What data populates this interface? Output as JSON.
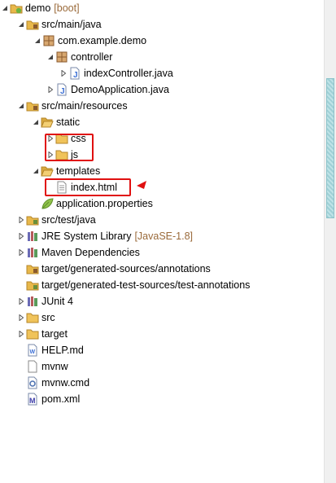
{
  "colors": {
    "annotation": "#e01010",
    "folder": "#e8b84a",
    "package": "#b9885a",
    "java": "#3b6fd6",
    "scrollbar": "#9fd0d6"
  },
  "tree": {
    "project": {
      "label": "demo",
      "decoration": "[boot]"
    },
    "src_main_java": "src/main/java",
    "pkg_demo": "com.example.demo",
    "pkg_controller": "controller",
    "file_indexController": "indexController.java",
    "file_DemoApplication": "DemoApplication.java",
    "src_main_resources": "src/main/resources",
    "static": "static",
    "css": "css",
    "js": "js",
    "templates": "templates",
    "index_html": "index.html",
    "application_properties": "application.properties",
    "src_test_java": "src/test/java",
    "jre": {
      "label": "JRE System Library",
      "decoration": "[JavaSE-1.8]"
    },
    "maven_deps": "Maven Dependencies",
    "gen_sources": "target/generated-sources/annotations",
    "gen_test_sources": "target/generated-test-sources/test-annotations",
    "junit": "JUnit 4",
    "src": "src",
    "target": "target",
    "help_md": "HELP.md",
    "mvnw": "mvnw",
    "mvnw_cmd": "mvnw.cmd",
    "pom_xml": "pom.xml"
  }
}
